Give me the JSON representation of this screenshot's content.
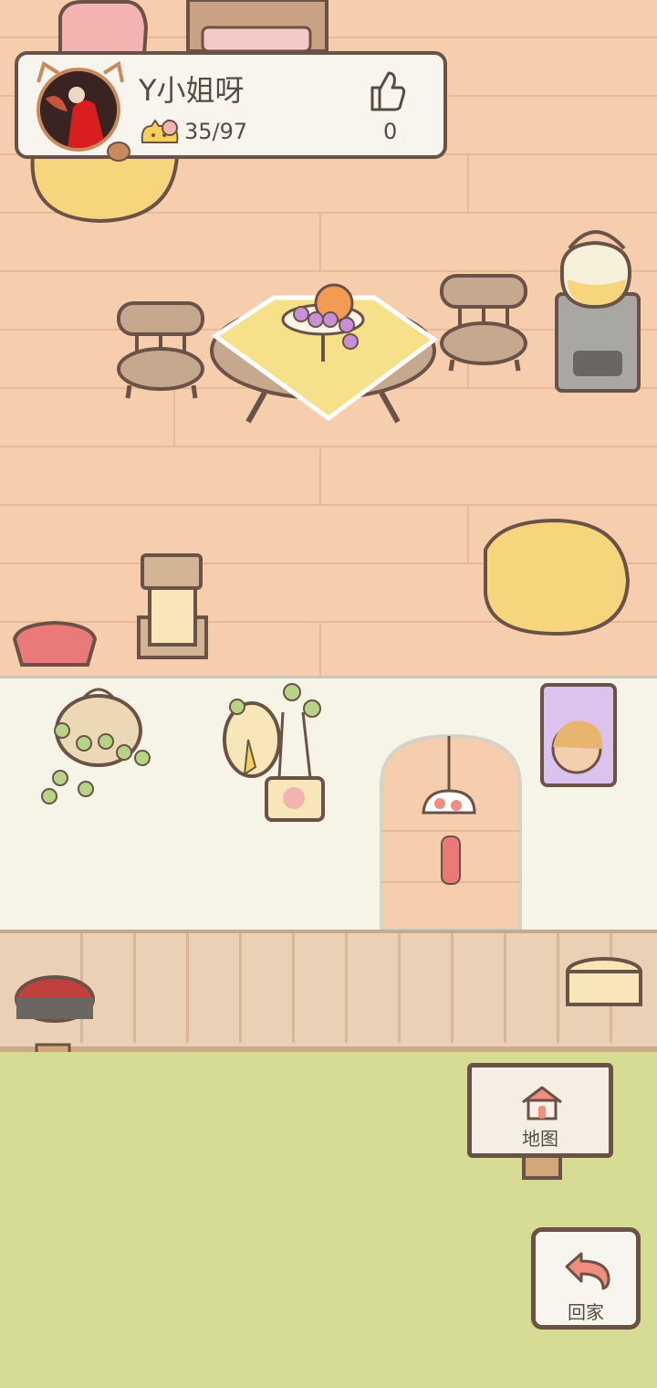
{
  "profile": {
    "name": "Y小姐呀",
    "progress_text": "35/97",
    "likes": "0"
  },
  "buttons": {
    "map_label": "地图",
    "home_label": "回家"
  },
  "colors": {
    "floor": "#f6cdad",
    "wall": "#f6f3e7",
    "grass": "#d6dc93",
    "outline": "#6b5246",
    "accent_pink": "#f08d7f",
    "cushion_yellow": "#f6d57c"
  },
  "icons": [
    "cat-coin-icon",
    "thumbs-up-icon",
    "house-icon",
    "return-arrow-icon"
  ]
}
